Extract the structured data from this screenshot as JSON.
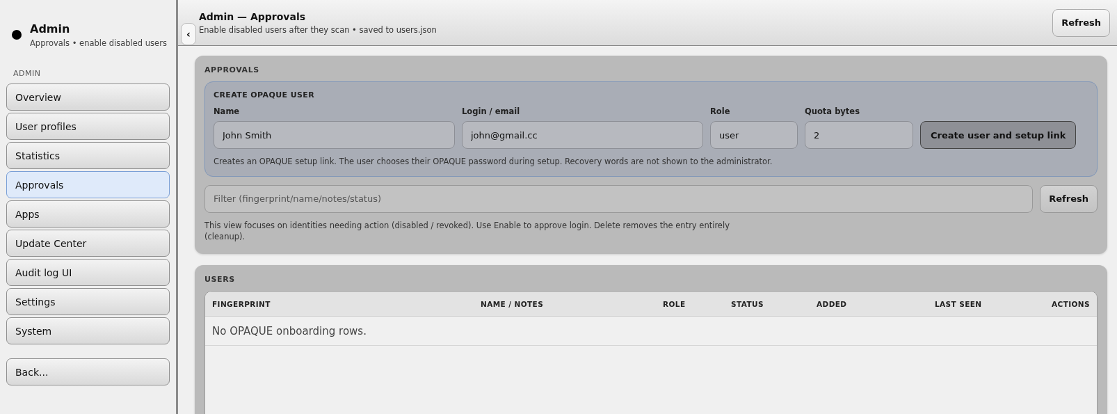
{
  "sidebar": {
    "title": "Admin",
    "subtitle": "Approvals • enable disabled users",
    "section": "ADMIN",
    "items": [
      {
        "label": "Overview",
        "selected": false
      },
      {
        "label": "User profiles",
        "selected": false
      },
      {
        "label": "Statistics",
        "selected": false
      },
      {
        "label": "Approvals",
        "selected": true
      },
      {
        "label": "Apps",
        "selected": false
      },
      {
        "label": "Update Center",
        "selected": false
      },
      {
        "label": "Audit log UI",
        "selected": false
      },
      {
        "label": "Settings",
        "selected": false
      },
      {
        "label": "System",
        "selected": false
      }
    ],
    "back_button": "Back...",
    "collapse_button": "‹"
  },
  "header": {
    "title": "Admin — Approvals",
    "subtitle": "Enable disabled users after they scan • saved to users.json",
    "refresh_button": "Refresh"
  },
  "approvals": {
    "heading": "APPROVALS",
    "create": {
      "heading": "CREATE OPAQUE USER",
      "fields": [
        {
          "label": "Name",
          "value": "John Smith"
        },
        {
          "label": "Login / email",
          "value": "john@gmail.cc"
        },
        {
          "label": "Role",
          "value": "user"
        },
        {
          "label": "Quota bytes",
          "value": "2"
        }
      ],
      "submit_button": "Create user and setup link",
      "note": "Creates an OPAQUE setup link. The user chooses their OPAQUE password during setup. Recovery words are not shown to the administrator."
    },
    "filter": {
      "placeholder": "Filter (fingerprint/name/notes/status)"
    },
    "refresh_button": "Refresh",
    "note": "This view focuses on identities needing action (disabled / revoked). Use Enable to approve login. Delete removes the entry entirely (cleanup)."
  },
  "users": {
    "heading": "USERS",
    "table": {
      "columns": [
        "FINGERPRINT",
        "NAME / NOTES",
        "ROLE",
        "STATUS",
        "ADDED",
        "LAST SEEN",
        "ACTIONS"
      ],
      "empty_message": "No OPAQUE onboarding rows."
    }
  }
}
